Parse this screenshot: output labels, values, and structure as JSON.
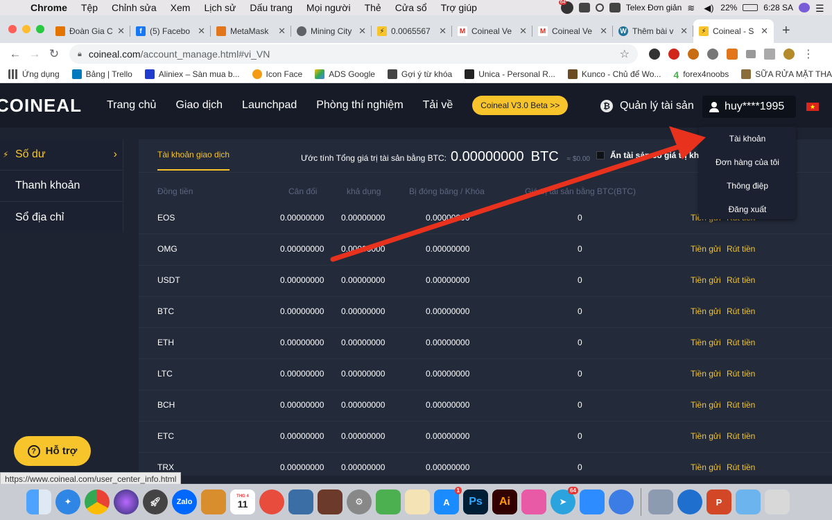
{
  "menubar": {
    "app": "Chrome",
    "items": [
      "Tệp",
      "Chỉnh sửa",
      "Xem",
      "Lịch sử",
      "Dấu trang",
      "Mọi người",
      "Thẻ",
      "Cửa sổ",
      "Trợ giúp"
    ],
    "input_method": "Telex Đơn giản",
    "battery": "22%",
    "time": "6:28 SA",
    "badge": "64"
  },
  "tabs": [
    {
      "title": "Đoàn Gia C",
      "color": "#e37400"
    },
    {
      "title": "(5) Facebo",
      "color": "#1877f2"
    },
    {
      "title": "MetaMask",
      "color": "#e2761b"
    },
    {
      "title": "Mining City",
      "color": "#5f6368"
    },
    {
      "title": "0.0065567",
      "color": "#f7c52b"
    },
    {
      "title": "Coineal Ve",
      "color": "#d93025"
    },
    {
      "title": "Coineal Ve",
      "color": "#d93025"
    },
    {
      "title": "Thêm bài v",
      "color": "#21759b"
    },
    {
      "title": "Coineal - S",
      "color": "#f7c52b"
    }
  ],
  "address": {
    "domain": "coineal.com",
    "path": "/account_manage.html#vi_VN"
  },
  "bookmarks": [
    "Ứng dụng",
    "Bảng | Trello",
    "Aliniex – Sàn mua b...",
    "Icon Face",
    "ADS Google",
    "Gợi ý từ khóa",
    "Unica - Personal R...",
    "Kunco - Chủ để Wo...",
    "forex4noobs",
    "SỮA RỬA MẶT THA..."
  ],
  "header": {
    "logo": "COINEAL",
    "nav": [
      "Trang chủ",
      "Giao dịch",
      "Launchpad",
      "Phòng thí nghiệm",
      "Tải về"
    ],
    "beta": "Coineal V3.0 Beta >>",
    "asset_manager": "Quản lý tài sản",
    "user": "huy****1995"
  },
  "dropdown": [
    "Tài khoản",
    "Đơn hàng của tôi",
    "Thông điệp",
    "Đăng xuất"
  ],
  "sidebar": [
    "Số dư",
    "Thanh khoản",
    "Sổ địa chỉ"
  ],
  "panel": {
    "tab": "Tài khoản giao dịch",
    "estimate_label": "Ước tính Tổng giá trị tài sản bằng BTC:",
    "estimate_value": "0.00000000",
    "estimate_unit": "BTC",
    "estimate_usd": "≈ $0.00",
    "hide_small": "Ẩn tài sản có giá trị khô"
  },
  "table": {
    "headers": [
      "Đồng tiền",
      "Cân đối",
      "khả dụng",
      "Bị đóng băng / Khóa",
      "Giá trị tài sản bằng BTC(BTC)"
    ],
    "deposit_label": "Tiền gửi",
    "withdraw_label": "Rút tiền",
    "rows": [
      {
        "coin": "EOS",
        "balance": "0.00000000",
        "available": "0.00000000",
        "frozen": "0.00000000",
        "btc": "0"
      },
      {
        "coin": "OMG",
        "balance": "0.00000000",
        "available": "0.00000000",
        "frozen": "0.00000000",
        "btc": "0"
      },
      {
        "coin": "USDT",
        "balance": "0.00000000",
        "available": "0.00000000",
        "frozen": "0.00000000",
        "btc": "0"
      },
      {
        "coin": "BTC",
        "balance": "0.00000000",
        "available": "0.00000000",
        "frozen": "0.00000000",
        "btc": "0"
      },
      {
        "coin": "ETH",
        "balance": "0.00000000",
        "available": "0.00000000",
        "frozen": "0.00000000",
        "btc": "0"
      },
      {
        "coin": "LTC",
        "balance": "0.00000000",
        "available": "0.00000000",
        "frozen": "0.00000000",
        "btc": "0"
      },
      {
        "coin": "BCH",
        "balance": "0.00000000",
        "available": "0.00000000",
        "frozen": "0.00000000",
        "btc": "0"
      },
      {
        "coin": "ETC",
        "balance": "0.00000000",
        "available": "0.00000000",
        "frozen": "0.00000000",
        "btc": "0"
      },
      {
        "coin": "TRX",
        "balance": "0.00000000",
        "available": "0.00000000",
        "frozen": "0.00000000",
        "btc": "0"
      }
    ]
  },
  "support": "Hỗ trợ",
  "status_url": "https://www.coineal.com/user_center_info.html",
  "dock": {
    "calendar_day": "11",
    "calendar_month": "THG 4",
    "zalo": "Zalo",
    "ps": "Ps",
    "ai": "Ai",
    "appstore_badge": "1",
    "telegram_badge": "64"
  },
  "colors": {
    "accent": "#f7c52b",
    "header_bg": "#161b27",
    "panel_bg": "#232a3a",
    "arrow": "#e8321e"
  }
}
